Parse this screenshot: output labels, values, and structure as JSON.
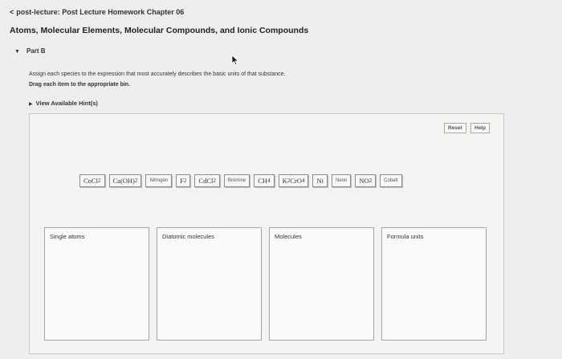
{
  "breadcrumb": {
    "chevron": "<",
    "text": "post-lecture: Post Lecture Homework Chapter 06"
  },
  "title": "Atoms, Molecular Elements, Molecular Compounds, and Ionic Compounds",
  "part": {
    "label": "Part B"
  },
  "instructions": {
    "line1": "Assign each species to the expression that most accurately describes the basic units of that substance.",
    "line2": "Drag each item to the appropriate bin."
  },
  "hints": {
    "label": "View Available Hint(s)"
  },
  "controls": {
    "reset": "Reset",
    "help": "Help"
  },
  "tiles": [
    {
      "name": "CoCl2",
      "base": "CoCl",
      "sub": "2"
    },
    {
      "name": "CaOH2",
      "base": "Ca(OH)",
      "sub": "2"
    },
    {
      "name": "Nitrogen",
      "word": "Nitrogen"
    },
    {
      "name": "F2",
      "base": "F",
      "sub": "2"
    },
    {
      "name": "CdCl2",
      "base": "CdCl",
      "sub": "2"
    },
    {
      "name": "Bromine",
      "word": "Bromine"
    },
    {
      "name": "CH4",
      "base": "CH",
      "sub": "4"
    },
    {
      "name": "K2CrO4",
      "base": "K",
      "sub": "2",
      "base2": "CrO",
      "sub2": "4"
    },
    {
      "name": "Ni",
      "base": "Ni"
    },
    {
      "name": "Neon",
      "word": "Neon"
    },
    {
      "name": "NO2",
      "base": "NO",
      "sub": "2"
    },
    {
      "name": "Cobalt",
      "word": "Cobalt"
    }
  ],
  "bins": [
    {
      "label": "Single atoms"
    },
    {
      "label": "Diatomic molecules"
    },
    {
      "label": "Molecules"
    },
    {
      "label": "Formula units"
    }
  ],
  "icons": {
    "cursor": "mouse-pointer-icon"
  }
}
